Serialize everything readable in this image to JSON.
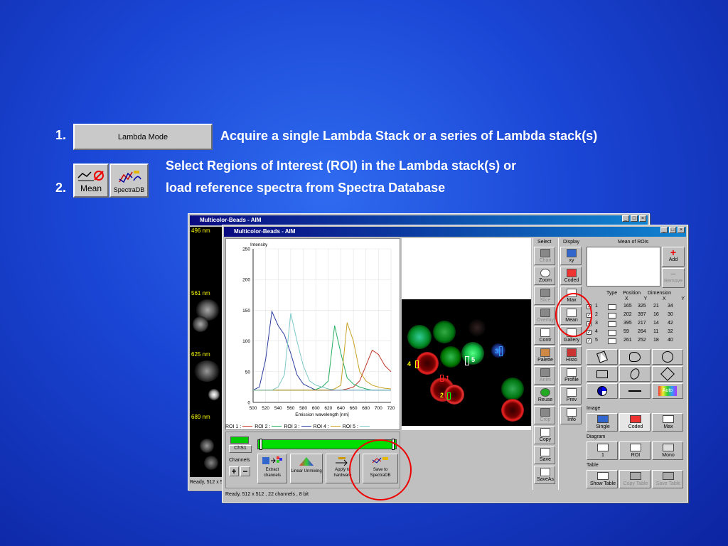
{
  "slide": {
    "step1_number": "1.",
    "step1_button": "Lambda Mode",
    "step1_text": "Acquire a single Lambda Stack or a series of Lambda stack(s)",
    "step2_line1": "Select Regions of Interest (ROI) in the Lambda stack(s) or",
    "step2_number": "2.",
    "step2_line2": "load reference spectra from Spectra Database",
    "mean_button": "Mean",
    "spectradb_button": "SpectraDB"
  },
  "back_window": {
    "title": "Multicolor-Beads - AIM",
    "channels": [
      "496 nm",
      "561 nm",
      "625 nm",
      "689 nm"
    ],
    "status": "Ready, 512 x 512"
  },
  "front_window": {
    "title": "Multicolor-Beads - AIM",
    "status": "Ready, 512 x 512 , 22 channels , 8 bit",
    "channel_name": "ChS1",
    "channels_label": "Channels",
    "buttons": {
      "extract": "Extract channels",
      "linear": "Linear Unmixing",
      "apply": "Apply to hardware",
      "save_spectra": "Save to SpectraDB"
    },
    "roi_legend": [
      "ROI 1 :",
      "ROI 2 :",
      "ROI 3 :",
      "ROI 4 :",
      "ROI 5 :"
    ],
    "select_header": "Select",
    "display_header": "Display",
    "select_tools": [
      "Chan",
      "Zoom",
      "Slice",
      "Overlay",
      "Contr",
      "Palette",
      "Anim",
      "Reuse",
      "Crop",
      "Copy",
      "Save",
      "SaveAs"
    ],
    "display_tools": [
      "xy",
      "Coded",
      "Max",
      "Mean",
      "Gallery",
      "Histo",
      "Profile",
      "Prev",
      "Info"
    ],
    "mean_rois_title": "Mean of ROIs",
    "add_label": "Add",
    "remove_label": "Remove",
    "roi_table_headers": [
      "Type",
      "Position",
      "Dimension"
    ],
    "roi_table_sub": [
      "X",
      "Y",
      "X",
      "Y"
    ],
    "roi_rows": [
      {
        "n": "1",
        "x": "165",
        "y": "325",
        "dx": "21",
        "dy": "34"
      },
      {
        "n": "2",
        "x": "202",
        "y": "397",
        "dx": "16",
        "dy": "30"
      },
      {
        "n": "3",
        "x": "395",
        "y": "217",
        "dx": "14",
        "dy": "42"
      },
      {
        "n": "4",
        "x": "59",
        "y": "264",
        "dx": "11",
        "dy": "32"
      },
      {
        "n": "5",
        "x": "261",
        "y": "252",
        "dx": "18",
        "dy": "40"
      }
    ],
    "auto_label": "Auto",
    "image_section": "Image",
    "image_buttons": [
      "Single",
      "Coded",
      "Max"
    ],
    "diagram_section": "Diagram",
    "diagram_buttons": [
      "1",
      "ROI",
      "Mono"
    ],
    "table_section": "Table",
    "table_buttons": [
      "Show Table",
      "Copy Table",
      "Save Table"
    ],
    "image_labels": [
      "4",
      "5",
      "3",
      "1",
      "2"
    ]
  },
  "chart_data": {
    "type": "line",
    "ylabel": "Intensity",
    "xlabel": "Emission wavelength [nm]",
    "ylim": [
      0,
      250
    ],
    "xlim": [
      500,
      720
    ],
    "yticks": [
      "250",
      "200",
      "150",
      "100",
      "50",
      "0"
    ],
    "xticks": [
      "500",
      "520",
      "540",
      "560",
      "580",
      "600",
      "620",
      "640",
      "660",
      "680",
      "700",
      "720"
    ],
    "x": [
      500,
      510,
      520,
      530,
      540,
      550,
      560,
      570,
      580,
      590,
      600,
      610,
      620,
      630,
      640,
      650,
      660,
      670,
      680,
      690,
      700,
      710,
      720
    ],
    "series": [
      {
        "name": "ROI 1",
        "color": "#c0392b",
        "values": [
          20,
          20,
          20,
          20,
          20,
          20,
          20,
          20,
          20,
          20,
          20,
          20,
          20,
          20,
          20,
          22,
          25,
          35,
          60,
          85,
          78,
          60,
          50
        ]
      },
      {
        "name": "ROI 2",
        "color": "#27ae60",
        "values": [
          20,
          20,
          20,
          20,
          20,
          20,
          20,
          20,
          20,
          20,
          21,
          25,
          35,
          125,
          80,
          40,
          30,
          25,
          22,
          20,
          20,
          20,
          20
        ]
      },
      {
        "name": "ROI 3",
        "color": "#2c3e9e",
        "values": [
          20,
          25,
          70,
          148,
          125,
          110,
          80,
          45,
          30,
          25,
          20,
          20,
          20,
          20,
          20,
          20,
          20,
          20,
          20,
          20,
          20,
          20,
          20
        ]
      },
      {
        "name": "ROI 4",
        "color": "#c9a227",
        "values": [
          20,
          20,
          20,
          20,
          20,
          20,
          20,
          20,
          20,
          20,
          20,
          20,
          20,
          22,
          28,
          130,
          100,
          50,
          35,
          28,
          25,
          23,
          22
        ]
      },
      {
        "name": "ROI 5",
        "color": "#7ec8c8",
        "values": [
          20,
          20,
          20,
          20,
          25,
          45,
          145,
          100,
          60,
          35,
          28,
          25,
          22,
          20,
          20,
          20,
          20,
          20,
          20,
          20,
          20,
          20,
          20
        ]
      }
    ]
  }
}
